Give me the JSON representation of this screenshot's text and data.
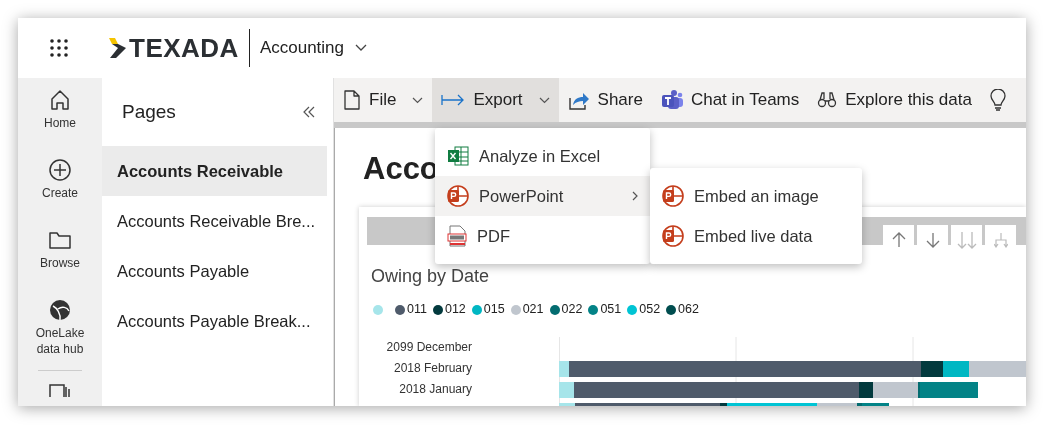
{
  "app_bar": {
    "brand": "TEXADA",
    "workspace": "Accounting"
  },
  "nav_rail": [
    {
      "label": "Home"
    },
    {
      "label": "Create"
    },
    {
      "label": "Browse"
    },
    {
      "label": "OneLake data hub"
    }
  ],
  "pages_panel": {
    "title": "Pages",
    "items": [
      {
        "label": "Accounts Receivable",
        "selected": true
      },
      {
        "label": "Accounts Receivable Bre...",
        "selected": false
      },
      {
        "label": "Accounts Payable",
        "selected": false
      },
      {
        "label": "Accounts Payable Break...",
        "selected": false
      }
    ]
  },
  "toolbar": [
    {
      "label": "File",
      "has_menu": true,
      "selected": false
    },
    {
      "label": "Export",
      "has_menu": true,
      "selected": true
    },
    {
      "label": "Share",
      "has_menu": false,
      "selected": false
    },
    {
      "label": "Chat in Teams",
      "has_menu": false,
      "selected": false
    },
    {
      "label": "Explore this data",
      "has_menu": false,
      "selected": false
    }
  ],
  "export_menu": [
    {
      "label": "Analyze in Excel",
      "selected": false,
      "has_submenu": false
    },
    {
      "label": "PowerPoint",
      "selected": true,
      "has_submenu": true
    },
    {
      "label": "PDF",
      "selected": false,
      "has_submenu": false
    }
  ],
  "powerpoint_submenu": [
    {
      "label": "Embed an image"
    },
    {
      "label": "Embed live data"
    }
  ],
  "report": {
    "title": "Acco",
    "visual": {
      "title": "Owing by Date",
      "legend": [
        {
          "color": "#a6e5ea"
        },
        {
          "label": "011",
          "color": "#4f5b6b"
        },
        {
          "label": "012",
          "color": "#033a3e"
        },
        {
          "label": "015",
          "color": "#00b7c3"
        },
        {
          "label": "021",
          "color": "#c0c6ce"
        },
        {
          "label": "022",
          "color": "#036c70"
        },
        {
          "label": "051",
          "color": "#038387"
        },
        {
          "label": "052",
          "color": "#00c4d4"
        },
        {
          "label": "062",
          "color": "#004d4f"
        }
      ],
      "rows": [
        "2099 December",
        "2018 February",
        "2018 January"
      ]
    }
  }
}
